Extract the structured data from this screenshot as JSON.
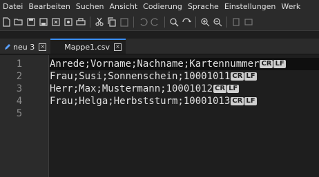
{
  "menu": [
    "Datei",
    "Bearbeiten",
    "Suchen",
    "Ansicht",
    "Codierung",
    "Sprache",
    "Einstellungen",
    "Werk"
  ],
  "toolbar": {
    "icons": [
      "new-file-icon",
      "open-folder-icon",
      "save-icon",
      "save-all-icon",
      "close-icon",
      "close-all-icon",
      "print-icon",
      "cut-icon",
      "copy-icon",
      "paste-icon",
      "undo-icon",
      "redo-icon",
      "find-icon",
      "replace-icon",
      "zoom-in-icon",
      "zoom-out-icon",
      "sync-icon",
      "wrap-icon"
    ]
  },
  "tabs": [
    {
      "label": "neu 3",
      "active": false,
      "close": "×"
    },
    {
      "label": "Mappe1.csv",
      "active": true,
      "close": "×"
    }
  ],
  "editor": {
    "line_numbers": [
      "1",
      "2",
      "3",
      "4",
      "5"
    ],
    "lines": [
      {
        "text": "Anrede;Vorname;Nachname;Kartennummer",
        "cr": "CR",
        "lf": "LF"
      },
      {
        "text": "Frau;Susi;Sonnenschein;10001011",
        "cr": "CR",
        "lf": "LF"
      },
      {
        "text": "Herr;Max;Mustermann;10001012",
        "cr": "CR",
        "lf": "LF"
      },
      {
        "text": "Frau;Helga;Herbststurm;10001013",
        "cr": "CR",
        "lf": "LF"
      },
      {
        "text": ""
      }
    ]
  }
}
